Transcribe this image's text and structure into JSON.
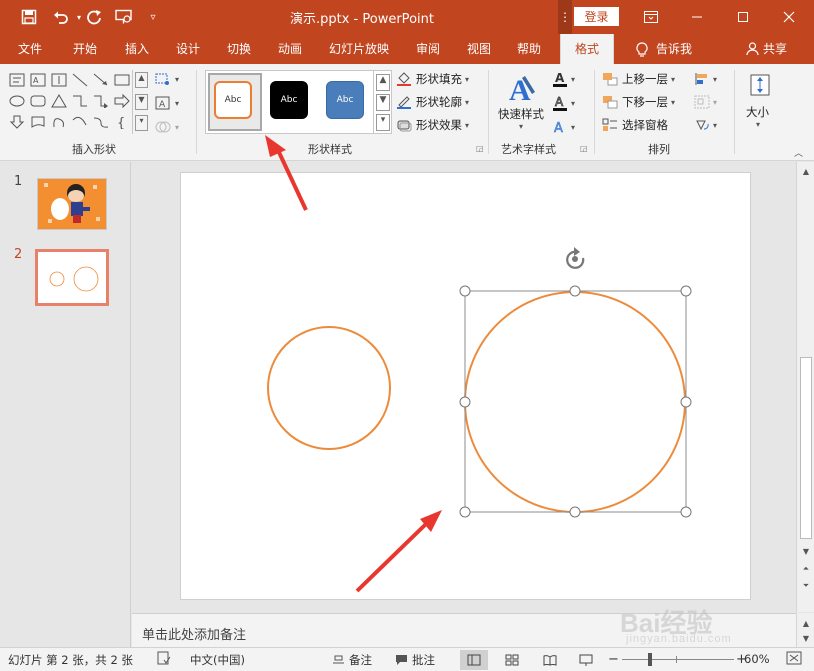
{
  "window": {
    "title": "演示.pptx  -  PowerPoint",
    "login_label": "登录",
    "dots": "⋮"
  },
  "tabs": [
    {
      "label": "文件"
    },
    {
      "label": "开始"
    },
    {
      "label": "插入"
    },
    {
      "label": "设计"
    },
    {
      "label": "切换"
    },
    {
      "label": "动画"
    },
    {
      "label": "幻灯片放映"
    },
    {
      "label": "审阅"
    },
    {
      "label": "视图"
    },
    {
      "label": "帮助"
    },
    {
      "label": "格式"
    }
  ],
  "active_tab": "格式",
  "tell_me": "告诉我",
  "share": "共享",
  "ribbon": {
    "groups": {
      "insert_shapes": "插入形状",
      "shape_styles": "形状样式",
      "wordart_styles": "艺术字样式",
      "arrange": "排列"
    },
    "style_samples": [
      {
        "text": "Abc",
        "fill": "#ffffff",
        "border": "#ed7d31",
        "color": "#333333"
      },
      {
        "text": "Abc",
        "fill": "#000000",
        "border": "#000000",
        "color": "#ffffff"
      },
      {
        "text": "Abc",
        "fill": "#4a7ebb",
        "border": "#3a6aa5",
        "color": "#ffffff"
      }
    ],
    "shape_fill": "形状填充",
    "shape_outline": "形状轮廓",
    "shape_effects": "形状效果",
    "quick_styles": "快速样式",
    "bring_forward": "上移一层",
    "send_backward": "下移一层",
    "selection_pane": "选择窗格",
    "size": "大小"
  },
  "slides": [
    {
      "number": "1"
    },
    {
      "number": "2"
    }
  ],
  "selected_slide": "2",
  "notes_placeholder": "单击此处添加备注",
  "status": {
    "slide_info": "幻灯片 第 2 张，共 2 张",
    "language": "中文(中国)",
    "notes": "备注",
    "comments": "批注",
    "zoom": "60%"
  },
  "watermark": {
    "main": "Bai经验",
    "sub": "jingyan.baidu.com"
  },
  "colors": {
    "accent": "#c1451f",
    "shape_outline": "#ed8b3c",
    "arrow": "#e8372f"
  }
}
